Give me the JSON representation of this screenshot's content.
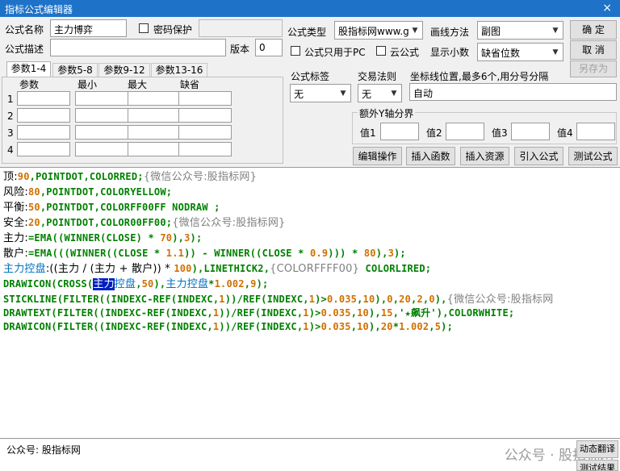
{
  "window": {
    "title": "指标公式编辑器",
    "close": "×"
  },
  "form": {
    "name_label": "公式名称",
    "name_value": "主力博弈",
    "password_label": "密码保护",
    "desc_label": "公式描述",
    "desc_value": "",
    "version_label": "版本",
    "version_value": "0",
    "type_label": "公式类型",
    "type_value": "股指标网www.g",
    "draw_label": "画线方法",
    "draw_value": "副图",
    "pc_only_label": "公式只用于PC",
    "cloud_label": "云公式",
    "decimals_label": "显示小数",
    "decimals_value": "缺省位数",
    "tag_label": "公式标签",
    "tag_value": "无",
    "trade_label": "交易法则",
    "trade_value": "无",
    "coord_label": "坐标线位置,最多6个,用分号分隔",
    "coord_value": "自动",
    "extra_y_label": "额外Y轴分界",
    "y_values": [
      "值1",
      "值2",
      "值3",
      "值4"
    ]
  },
  "buttons": {
    "ok": "确 定",
    "cancel": "取 消",
    "save_as": "另存为",
    "edit_op": "编辑操作",
    "insert_func": "插入函数",
    "insert_res": "插入资源",
    "import_formula": "引入公式",
    "test_formula": "测试公式",
    "dynamic_translate": "动态翻译",
    "test_result": "测试结果"
  },
  "params": {
    "tabs": [
      "参数1-4",
      "参数5-8",
      "参数9-12",
      "参数13-16"
    ],
    "headers": [
      "参数",
      "最小",
      "最大",
      "缺省"
    ],
    "rows": [
      "1",
      "2",
      "3",
      "4"
    ]
  },
  "code": {
    "l1": {
      "a": "顶:",
      "b": "90",
      "c": ",POINTDOT,COLORRED;",
      "d": "{微信公众号:股指标网}"
    },
    "l2": {
      "a": "风险:",
      "b": "80",
      "c": ",POINTDOT,COLORYELLOW;"
    },
    "l3": {
      "a": "平衡:",
      "b": "50",
      "c": ",POINTDOT,COLORFF00FF NODRAW ;"
    },
    "l4": {
      "a": "安全:",
      "b": "20",
      "c": ",POINTDOT,COLOR00FF00;",
      "d": "{微信公众号:股指标网}"
    },
    "l5": {
      "a": "主力:",
      "b": "=EMA((",
      "c": "WINNER",
      "d": "(CLOSE) * ",
      "e": "70",
      "f": "),",
      "g": "3",
      "h": ");"
    },
    "l6": {
      "a": "散户:",
      "b": "=EMA(((",
      "c": "WINNER",
      "d": "((CLOSE * ",
      "e": "1.1",
      "f": ")) - ",
      "g": "WINNER",
      "h": "((CLOSE * ",
      "i": "0.9",
      "j": "))) * ",
      "k": "80",
      "l": "),",
      "m": "3",
      "n": ");"
    },
    "l7": {
      "a": "主力控盘",
      "b": ":((主力 / (主力 + 散户)) * ",
      "c": "100",
      "d": "),LINETHICK2,",
      "e": "{COLORFFFF00}",
      "f": " COLORLIRED;"
    },
    "l8": {
      "a": "DRAWICON(CROSS(",
      "b": "主力",
      "c": "控盘",
      "d": ",",
      "e": "50",
      "f": "),",
      "g": "主力控盘",
      "h": "*",
      "i": "1.002",
      "j": ",",
      "k": "9",
      "l": ");"
    },
    "l9": {
      "a": "STICKLINE(FILTER((INDEXC-REF(INDEXC,",
      "b": "1",
      "c": "))/REF(INDEXC,",
      "d": "1",
      "e": ")>",
      "f": "0.035",
      "g": ",",
      "h": "10",
      "i": "),",
      "j": "0",
      "k": ",",
      "l": "20",
      "m": ",",
      "n": "2",
      "o": ",",
      "p": "0",
      "q": "),",
      "r": "{微信公众号:股指标网"
    },
    "l10": {
      "a": "DRAWTEXT(FILTER((INDEXC-REF(INDEXC,",
      "b": "1",
      "c": "))/REF(INDEXC,",
      "d": "1",
      "e": ")>",
      "f": "0.035",
      "g": ",",
      "h": "10",
      "i": "),",
      "j": "15",
      "k": ",'★飙升'),COLORWHITE;"
    },
    "l11": {
      "a": "DRAWICON(FILTER((INDEXC-REF(INDEXC,",
      "b": "1",
      "c": "))/REF(INDEXC,",
      "d": "1",
      "e": ")>",
      "f": "0.035",
      "g": ",",
      "h": "10",
      "i": "),",
      "j": "20",
      "k": "*",
      "l": "1.002",
      "m": ",",
      "n": "5",
      "o": ");"
    }
  },
  "status": {
    "text": "公众号: 股指标网",
    "watermark": "公众号 · 股指标网"
  }
}
